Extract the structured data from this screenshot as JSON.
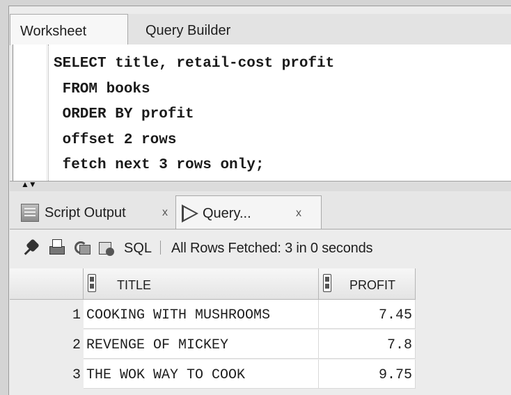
{
  "editor_tabs": [
    {
      "label": "Worksheet",
      "active": true
    },
    {
      "label": "Query Builder",
      "active": false
    }
  ],
  "sql_lines": [
    "SELECT title, retail-cost profit",
    " FROM books",
    " ORDER BY profit",
    " offset 2 rows",
    " fetch next 3 rows only;"
  ],
  "result_tabs": {
    "script_output": {
      "label": "Script Output",
      "close": "x",
      "icon": "script-output-icon"
    },
    "query_result": {
      "label": "Query...",
      "close": "x",
      "icon": "play-icon"
    }
  },
  "toolbar": {
    "icons": [
      "pin-icon",
      "print-icon",
      "refresh-icon",
      "export-icon"
    ],
    "sql_label": "SQL",
    "separator": "|",
    "status": "All Rows Fetched: 3 in 0 seconds"
  },
  "grid": {
    "columns": [
      "TITLE",
      "PROFIT"
    ],
    "rows": [
      {
        "num": "1",
        "title": "COOKING WITH MUSHROOMS",
        "profit": "7.45"
      },
      {
        "num": "2",
        "title": "REVENGE OF MICKEY",
        "profit": "7.8"
      },
      {
        "num": "3",
        "title": "THE WOK WAY TO COOK",
        "profit": "9.75"
      }
    ]
  }
}
